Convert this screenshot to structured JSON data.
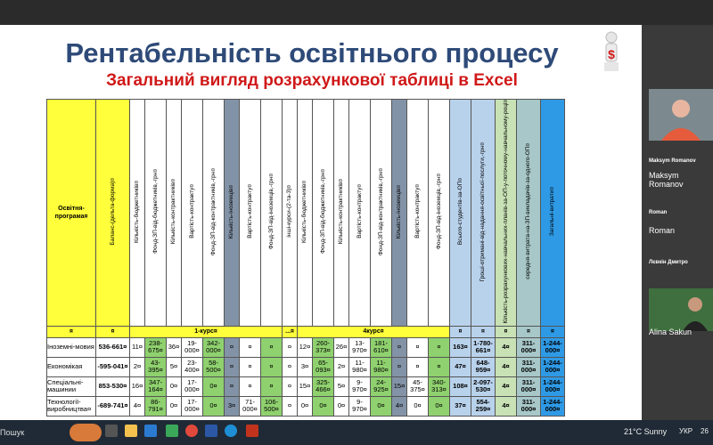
{
  "slide": {
    "title": "Рентабельність освітнього процесу",
    "subtitle": "Загальний вигляд розрахункової таблиці в Excel",
    "group_labels": {
      "first": "1-курс¤",
      "dots": "...¤",
      "fourth": "4курс¤"
    },
    "headers": [
      "Освітня-програма¤",
      "Баланс-(дельта-форма)¤",
      "Кількість-бюджетників¤",
      "Фонд-ЗП-від-бюджетників,-грн¤",
      "Кількість-контрактників¤",
      "Вартість-контракту¤",
      "Фонд-ЗП-від-контрактників,-грн¤",
      "Кількість-іноземців¤",
      "Вартість-контракту¤",
      "Фонд-ЗП-від-іноземців,-грн¤",
      "інші-курси-(2-та-3)¤",
      "Кількість-бюджетників¤",
      "Фонд-ЗП-від-бюджетників,-грн¤",
      "Кількість-контрактників¤",
      "Вартість-контракту¤",
      "Фонд-ЗП-від-контрактників,-грн¤",
      "Кількість-іноземців¤",
      "Вартість-контракту¤",
      "Фонд-ЗП-від-іноземців,-грн¤",
      "Всього-студентів-за-ОП¤",
      "Гроші-отримані-від-надання-освітньої-послуги,-грн¤",
      "Кількість-розрахункових-навчальних-планів-за-ОП-у-поточному-навчальному-році¤",
      "середня-витрата-на-ЗП-викладачів-за-одного-ОП¤",
      "Загальні-витрати¤"
    ],
    "rows": [
      [
        "Іноземні-мовия",
        "536-661¤",
        "11¤",
        "238-675¤",
        "36¤",
        "19-000¤",
        "342-000¤",
        "¤",
        "¤",
        "¤",
        "¤",
        "12¤",
        "260-373¤",
        "26¤",
        "13-970¤",
        "181-610¤",
        "¤",
        "¤",
        "¤",
        "163¤",
        "1-780-661¤",
        "4¤",
        "311-000¤",
        "1-244-000¤"
      ],
      [
        "Економікая",
        "-595-041¤",
        "2¤",
        "43-395¤",
        "5¤",
        "23-400¤",
        "58-500¤",
        "¤",
        "¤",
        "¤",
        "¤",
        "3¤",
        "65-093¤",
        "2¤",
        "11-980¤",
        "11-980¤",
        "¤",
        "¤",
        "¤",
        "47¤",
        "648-959¤",
        "4¤",
        "311-000¤",
        "1-244-000¤"
      ],
      [
        "Спеціальні-машинии",
        "853-530¤",
        "16¤",
        "347-164¤",
        "0¤",
        "17-000¤",
        "0¤",
        "¤",
        "¤",
        "¤",
        "¤",
        "15¤",
        "325-466¤",
        "5¤",
        "9-970¤",
        "24-925¤",
        "15¤",
        "45-375¤",
        "340-313¤",
        "108¤",
        "2-097-530¤",
        "4¤",
        "311-000¤",
        "1-244-000¤"
      ],
      [
        "Технології-виробництва¤",
        "-689-741¤",
        "4¤",
        "86-791¤",
        "0¤",
        "17-000¤",
        "0¤",
        "3¤",
        "71-000¤",
        "106-500¤",
        "¤",
        "0¤",
        "0¤",
        "0¤",
        "9-970¤",
        "0¤",
        "4¤",
        "0¤",
        "0¤",
        "37¤",
        "554-259¤",
        "4¤",
        "311-000¤",
        "1-244-000¤"
      ]
    ]
  },
  "participants": [
    {
      "label": "Maksym Romanov",
      "name": "Maksym Romanov"
    },
    {
      "label": "Roman",
      "name": "Roman"
    },
    {
      "label": "Лєвкін Дмитро",
      "name": ""
    },
    {
      "label": "",
      "name": "Alina Sakun"
    }
  ],
  "taskbar": {
    "search": "Пошук",
    "weather": "21°C  Sunny",
    "lang": "УКР",
    "clock": "26"
  },
  "colors": {
    "title": "#2e4a78",
    "subtitle": "#d01818",
    "yellow": "#ffff3b",
    "green": "#8fd16e",
    "blue": "#2e9ae6",
    "gray": "#8393a7"
  }
}
